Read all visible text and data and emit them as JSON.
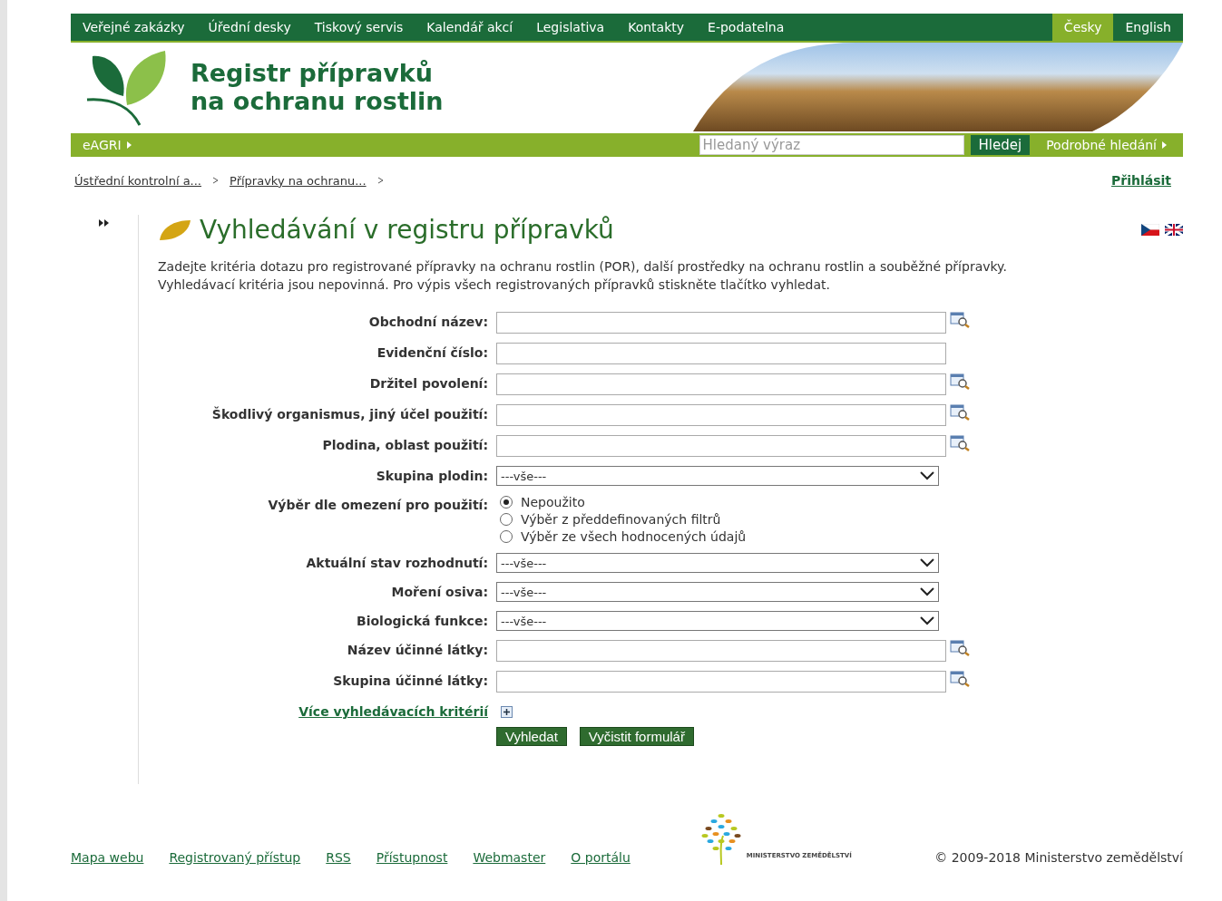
{
  "top_nav": {
    "items": [
      {
        "label": "Veřejné zakázky"
      },
      {
        "label": "Úřední desky"
      },
      {
        "label": "Tiskový servis"
      },
      {
        "label": "Kalendář akcí"
      },
      {
        "label": "Legislativa"
      },
      {
        "label": "Kontakty"
      },
      {
        "label": "E-podatelna"
      }
    ],
    "languages": [
      {
        "label": "Česky",
        "selected": true
      },
      {
        "label": "English",
        "selected": false
      }
    ]
  },
  "header": {
    "title_lines": [
      "Registr přípravků",
      "na ochranu rostlin"
    ]
  },
  "sub_nav": {
    "portal": "eAGRI",
    "search": {
      "placeholder": "Hledaný výraz"
    },
    "search_button": "Hledej",
    "advanced": "Podrobné hledání"
  },
  "breadcrumbs": [
    {
      "label": "Ústřední kontrolní a..."
    },
    {
      "label": "Přípravky na ochranu..."
    }
  ],
  "login": "Přihlásit",
  "heading": "Vyhledávání v registru přípravků",
  "intro": [
    "Zadejte kritéria dotazu pro registrované přípravky na ochranu rostlin (POR), další prostředky na ochranu rostlin a souběžné přípravky.",
    "Vyhledávací kritéria jsou nepovinná. Pro výpis všech registrovaných přípravků stiskněte tlačítko vyhledat."
  ],
  "form": {
    "fields": [
      {
        "kind": "text",
        "label": "Obchodní název:",
        "lookup": true
      },
      {
        "kind": "text",
        "label": "Evidenční číslo:",
        "lookup": false
      },
      {
        "kind": "text",
        "label": "Držitel povolení:",
        "lookup": true
      },
      {
        "kind": "text",
        "label": "Škodlivý organismus, jiný účel použití:",
        "lookup": true
      },
      {
        "kind": "text",
        "label": "Plodina, oblast použití:",
        "lookup": true
      },
      {
        "kind": "select",
        "label": "Skupina plodin:",
        "value": "---vše---"
      },
      {
        "kind": "radio",
        "label": "Výběr dle omezení pro použití:",
        "options": [
          {
            "label": "Nepoužito",
            "selected": true
          },
          {
            "label": "Výběr z předdefinovaných filtrů",
            "selected": false
          },
          {
            "label": "Výběr ze všech hodnocených údajů",
            "selected": false
          }
        ]
      },
      {
        "kind": "select",
        "label": "Aktuální stav rozhodnutí:",
        "value": "---vše---"
      },
      {
        "kind": "select",
        "label": "Moření osiva:",
        "value": "---vše---"
      },
      {
        "kind": "select",
        "label": "Biologická funkce:",
        "value": "---vše---"
      },
      {
        "kind": "text",
        "label": "Název účinné látky:",
        "lookup": true
      },
      {
        "kind": "text",
        "label": "Skupina účinné látky:",
        "lookup": true
      }
    ],
    "more_link": "Více vyhledávacích kritérií",
    "buttons": [
      "Vyhledat",
      "Vyčistit formulář"
    ]
  },
  "footer": {
    "links": [
      "Mapa webu",
      "Registrovaný přístup",
      "RSS",
      "Přístupnost",
      "Webmaster",
      "O portálu"
    ],
    "logo_text": "MINISTERSTVO ZEMĚDĚLSTVÍ",
    "copyright": "© 2009-2018 Ministerstvo zemědělství"
  }
}
